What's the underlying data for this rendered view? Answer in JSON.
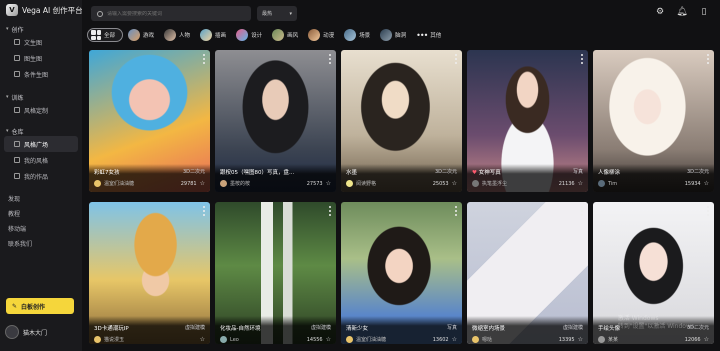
{
  "app": {
    "title": "Vega AI 创作平台",
    "logo_glyph": "V"
  },
  "sidebar": {
    "groups": [
      {
        "label": "创作",
        "items": [
          "文生图",
          "图生图",
          "条件生图"
        ]
      },
      {
        "label": "训练",
        "items": [
          "风格定制"
        ]
      },
      {
        "label": "仓库",
        "items": [
          "风格广场",
          "我的风格",
          "我的作品"
        ]
      }
    ],
    "active_item": "风格广场",
    "links": [
      "发现",
      "教程",
      "移动端",
      "联系我们"
    ],
    "subscribe_label": "白板创作",
    "user_name": "猫木大门"
  },
  "search": {
    "placeholder": "请输入需要搜索的关键词"
  },
  "sort": {
    "selected": "最热"
  },
  "top_icons": [
    "settings-icon",
    "bell-icon",
    "phone-icon"
  ],
  "categories": [
    "全部",
    "游戏",
    "人物",
    "插画",
    "设计",
    "画风",
    "动漫",
    "场景",
    "脑洞",
    "其他"
  ],
  "active_category": "全部",
  "cards": [
    {
      "title": "彩虹7女孩",
      "tag": "3D二次元",
      "author": "温室们油油糖",
      "count": "29781"
    },
    {
      "title": "跟桉05（嘿图80）写真，盘...",
      "tag": "",
      "author": "墨桉的桉",
      "count": "27573"
    },
    {
      "title": "水墨",
      "tag": "3D二次元",
      "author": "阅读野格",
      "count": "25053"
    },
    {
      "title": "女神写真",
      "tag": "写真",
      "author": "执笔墨浮尘",
      "count": "21136"
    },
    {
      "title": "人像柳涂",
      "tag": "3D二次元",
      "author": "Tim",
      "count": "15934"
    },
    {
      "title": "3D卡通潮玩IP",
      "tag": "虚拟建模",
      "author": "猫说漫玉",
      "count": ""
    },
    {
      "title": "化妆品-自然环境",
      "tag": "虚拟建模",
      "author": "Leo",
      "count": "14556"
    },
    {
      "title": "清新少女",
      "tag": "写真",
      "author": "温室们油油糖",
      "count": "13602"
    },
    {
      "title": "微缩室内场景",
      "tag": "虚拟建模",
      "author": "嗯哒",
      "count": "13395"
    },
    {
      "title": "手绘头像",
      "tag": "3D二次元",
      "author": "某某",
      "count": "12066"
    }
  ],
  "watermark": {
    "line1": "激活 Windows",
    "line2": "转到\"设置\"以激活 Windows。"
  }
}
